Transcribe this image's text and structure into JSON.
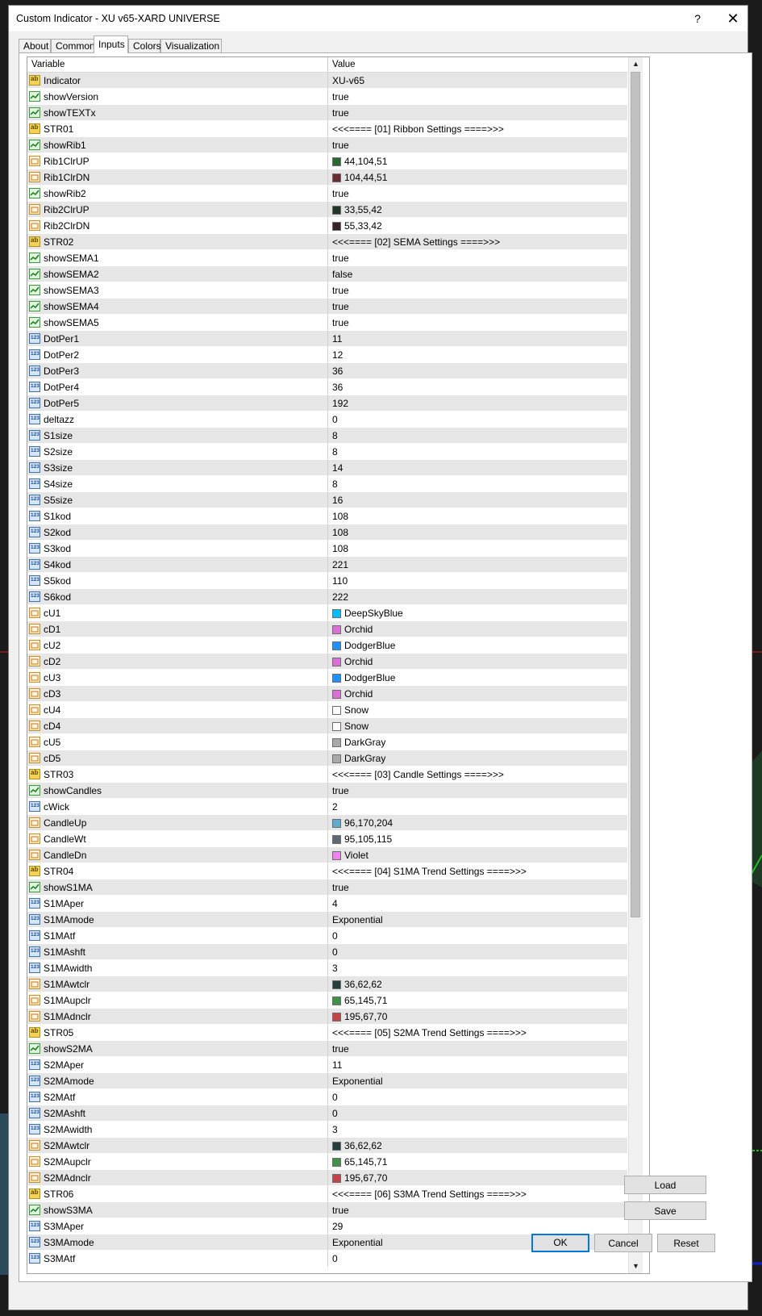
{
  "window": {
    "title": "Custom Indicator - XU v65-XARD UNIVERSE",
    "help": "?",
    "close": "✕"
  },
  "tabs": [
    "About",
    "Common",
    "Inputs",
    "Colors",
    "Visualization"
  ],
  "active_tab": "Inputs",
  "grid": {
    "headers": {
      "variable": "Variable",
      "value": "Value"
    },
    "rows": [
      {
        "type": "str",
        "name": "Indicator",
        "value": "XU-v65"
      },
      {
        "type": "bool",
        "name": "showVersion",
        "value": "true"
      },
      {
        "type": "bool",
        "name": "showTEXTx",
        "value": "true"
      },
      {
        "type": "str",
        "name": "STR01",
        "value": "<<<==== [01] Ribbon Settings ====>>>"
      },
      {
        "type": "bool",
        "name": "showRib1",
        "value": "true"
      },
      {
        "type": "clr",
        "name": "Rib1ClrUP",
        "value": "44,104,51",
        "color": "#2c6833"
      },
      {
        "type": "clr",
        "name": "Rib1ClrDN",
        "value": "104,44,51",
        "color": "#682c33"
      },
      {
        "type": "bool",
        "name": "showRib2",
        "value": "true"
      },
      {
        "type": "clr",
        "name": "Rib2ClrUP",
        "value": "33,55,42",
        "color": "#21372a"
      },
      {
        "type": "clr",
        "name": "Rib2ClrDN",
        "value": "55,33,42",
        "color": "#37212a"
      },
      {
        "type": "str",
        "name": "STR02",
        "value": "<<<==== [02] SEMA Settings ====>>>"
      },
      {
        "type": "bool",
        "name": "showSEMA1",
        "value": "true"
      },
      {
        "type": "bool",
        "name": "showSEMA2",
        "value": "false"
      },
      {
        "type": "bool",
        "name": "showSEMA3",
        "value": "true"
      },
      {
        "type": "bool",
        "name": "showSEMA4",
        "value": "true"
      },
      {
        "type": "bool",
        "name": "showSEMA5",
        "value": "true"
      },
      {
        "type": "int",
        "name": "DotPer1",
        "value": "11"
      },
      {
        "type": "int",
        "name": "DotPer2",
        "value": "12"
      },
      {
        "type": "int",
        "name": "DotPer3",
        "value": "36"
      },
      {
        "type": "int",
        "name": "DotPer4",
        "value": "36"
      },
      {
        "type": "int",
        "name": "DotPer5",
        "value": "192"
      },
      {
        "type": "int",
        "name": "deltazz",
        "value": "0"
      },
      {
        "type": "int",
        "name": "S1size",
        "value": "8"
      },
      {
        "type": "int",
        "name": "S2size",
        "value": "8"
      },
      {
        "type": "int",
        "name": "S3size",
        "value": "14"
      },
      {
        "type": "int",
        "name": "S4size",
        "value": "8"
      },
      {
        "type": "int",
        "name": "S5size",
        "value": "16"
      },
      {
        "type": "int",
        "name": "S1kod",
        "value": "108"
      },
      {
        "type": "int",
        "name": "S2kod",
        "value": "108"
      },
      {
        "type": "int",
        "name": "S3kod",
        "value": "108"
      },
      {
        "type": "int",
        "name": "S4kod",
        "value": "221"
      },
      {
        "type": "int",
        "name": "S5kod",
        "value": "110"
      },
      {
        "type": "int",
        "name": "S6kod",
        "value": "222"
      },
      {
        "type": "clr",
        "name": "cU1",
        "value": "DeepSkyBlue",
        "color": "#00bfff"
      },
      {
        "type": "clr",
        "name": "cD1",
        "value": "Orchid",
        "color": "#da70d6"
      },
      {
        "type": "clr",
        "name": "cU2",
        "value": "DodgerBlue",
        "color": "#1e90ff"
      },
      {
        "type": "clr",
        "name": "cD2",
        "value": "Orchid",
        "color": "#da70d6"
      },
      {
        "type": "clr",
        "name": "cU3",
        "value": "DodgerBlue",
        "color": "#1e90ff"
      },
      {
        "type": "clr",
        "name": "cD3",
        "value": "Orchid",
        "color": "#da70d6"
      },
      {
        "type": "clr",
        "name": "cU4",
        "value": "Snow",
        "color": "#fffafa"
      },
      {
        "type": "clr",
        "name": "cD4",
        "value": "Snow",
        "color": "#fffafa"
      },
      {
        "type": "clr",
        "name": "cU5",
        "value": "DarkGray",
        "color": "#a9a9a9"
      },
      {
        "type": "clr",
        "name": "cD5",
        "value": "DarkGray",
        "color": "#a9a9a9"
      },
      {
        "type": "str",
        "name": "STR03",
        "value": "<<<==== [03] Candle Settings ====>>>"
      },
      {
        "type": "bool",
        "name": "showCandles",
        "value": "true"
      },
      {
        "type": "int",
        "name": "cWick",
        "value": "2"
      },
      {
        "type": "clr",
        "name": "CandleUp",
        "value": "96,170,204",
        "color": "#60aacc"
      },
      {
        "type": "clr",
        "name": "CandleWt",
        "value": "95,105,115",
        "color": "#5f6973"
      },
      {
        "type": "clr",
        "name": "CandleDn",
        "value": "Violet",
        "color": "#ee82ee"
      },
      {
        "type": "str",
        "name": "STR04",
        "value": "<<<==== [04] S1MA Trend Settings ====>>>"
      },
      {
        "type": "bool",
        "name": "showS1MA",
        "value": "true"
      },
      {
        "type": "int",
        "name": "S1MAper",
        "value": "4"
      },
      {
        "type": "int",
        "name": "S1MAmode",
        "value": "Exponential"
      },
      {
        "type": "int",
        "name": "S1MAtf",
        "value": "0"
      },
      {
        "type": "int",
        "name": "S1MAshft",
        "value": "0"
      },
      {
        "type": "int",
        "name": "S1MAwidth",
        "value": "3"
      },
      {
        "type": "clr",
        "name": "S1MAwtclr",
        "value": "36,62,62",
        "color": "#243e3e"
      },
      {
        "type": "clr",
        "name": "S1MAupclr",
        "value": "65,145,71",
        "color": "#419147"
      },
      {
        "type": "clr",
        "name": "S1MAdnclr",
        "value": "195,67,70",
        "color": "#c34346"
      },
      {
        "type": "str",
        "name": "STR05",
        "value": "<<<==== [05] S2MA Trend Settings ====>>>"
      },
      {
        "type": "bool",
        "name": "showS2MA",
        "value": "true"
      },
      {
        "type": "int",
        "name": "S2MAper",
        "value": "11"
      },
      {
        "type": "int",
        "name": "S2MAmode",
        "value": "Exponential"
      },
      {
        "type": "int",
        "name": "S2MAtf",
        "value": "0"
      },
      {
        "type": "int",
        "name": "S2MAshft",
        "value": "0"
      },
      {
        "type": "int",
        "name": "S2MAwidth",
        "value": "3"
      },
      {
        "type": "clr",
        "name": "S2MAwtclr",
        "value": "36,62,62",
        "color": "#243e3e"
      },
      {
        "type": "clr",
        "name": "S2MAupclr",
        "value": "65,145,71",
        "color": "#419147"
      },
      {
        "type": "clr",
        "name": "S2MAdnclr",
        "value": "195,67,70",
        "color": "#c34346"
      },
      {
        "type": "str",
        "name": "STR06",
        "value": "<<<==== [06] S3MA Trend Settings ====>>>"
      },
      {
        "type": "bool",
        "name": "showS3MA",
        "value": "true"
      },
      {
        "type": "int",
        "name": "S3MAper",
        "value": "29"
      },
      {
        "type": "int",
        "name": "S3MAmode",
        "value": "Exponential"
      },
      {
        "type": "int",
        "name": "S3MAtf",
        "value": "0"
      }
    ]
  },
  "buttons": {
    "load": "Load",
    "save": "Save",
    "ok": "OK",
    "cancel": "Cancel",
    "reset": "Reset"
  },
  "scrollbar": {
    "up_arrow": "▲",
    "down_arrow": "▼"
  }
}
